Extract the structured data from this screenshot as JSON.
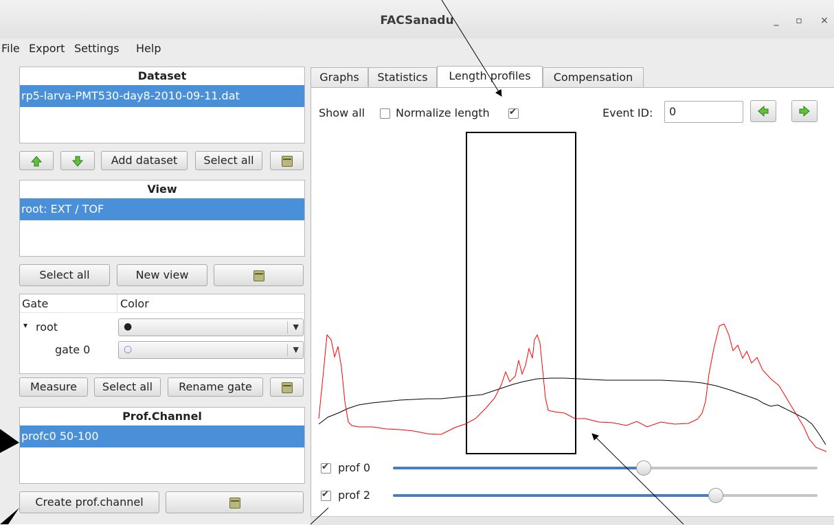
{
  "window": {
    "title": "FACSanadu",
    "minimize": "_",
    "maximize": "▫",
    "close": "×"
  },
  "menu": [
    "File",
    "Export",
    "Settings",
    "Help"
  ],
  "dataset": {
    "header": "Dataset",
    "selected": "rp5-larva-PMT530-day8-2010-09-11.dat",
    "buttons": {
      "add": "Add dataset",
      "select_all": "Select all"
    }
  },
  "view": {
    "header": "View",
    "selected": "root: EXT / TOF",
    "buttons": {
      "select_all": "Select all",
      "new_view": "New view"
    }
  },
  "gates": {
    "col_gate": "Gate",
    "col_color": "Color",
    "rows": [
      {
        "name": "root",
        "expander": "▾",
        "color_glyph": "●"
      },
      {
        "name": "gate 0",
        "expander": "",
        "color_glyph": "○"
      }
    ],
    "buttons": {
      "measure": "Measure",
      "select_all": "Select all",
      "rename": "Rename gate"
    }
  },
  "prof_channel": {
    "header": "Prof.Channel",
    "selected": "profc0 50-100",
    "buttons": {
      "create": "Create prof.channel"
    }
  },
  "tabs": [
    "Graphs",
    "Statistics",
    "Length profiles",
    "Compensation"
  ],
  "active_tab": "Length profiles",
  "length_profiles": {
    "show_all_label": "Show all",
    "show_all_checked": false,
    "normalize_label": "Normalize length",
    "normalize_checked": true,
    "event_id_label": "Event ID:",
    "event_id_value": "0",
    "profiles": [
      {
        "label": "prof 0",
        "checked": true,
        "slider_fraction": 0.59
      },
      {
        "label": "prof 2",
        "checked": true,
        "slider_fraction": 0.76
      }
    ]
  },
  "colors": {
    "selection": "#4a90d9",
    "slider": "#4a7ebf",
    "red_curve": "#ff0000",
    "black_curve": "#000000",
    "nav_arrow": "#5fc23a"
  }
}
